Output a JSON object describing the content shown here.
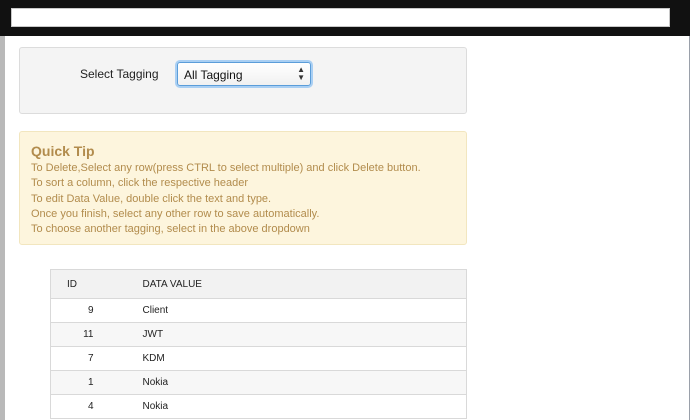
{
  "window": {
    "title_field_value": ""
  },
  "filter": {
    "label": "Select Tagging",
    "selected": "All Tagging"
  },
  "quick_tip": {
    "title": "Quick Tip",
    "lines": [
      "To Delete,Select any row(press CTRL to select multiple) and click Delete button.",
      "To sort a column, click the respective header",
      "To edit Data Value, double click the text and type.",
      "Once you finish, select any other row to save automatically.",
      "To choose another tagging, select in the above dropdown"
    ]
  },
  "table": {
    "headers": {
      "id": "ID",
      "value": "DATA VALUE"
    },
    "rows": [
      {
        "id": "9",
        "value": "Client"
      },
      {
        "id": "11",
        "value": "JWT"
      },
      {
        "id": "7",
        "value": "KDM"
      },
      {
        "id": "1",
        "value": "Nokia"
      },
      {
        "id": "4",
        "value": "Nokia"
      }
    ]
  },
  "colors": {
    "tip_background": "#fdf5dd",
    "tip_text": "#b28c4d",
    "select_focus": "#5b9dd9"
  }
}
